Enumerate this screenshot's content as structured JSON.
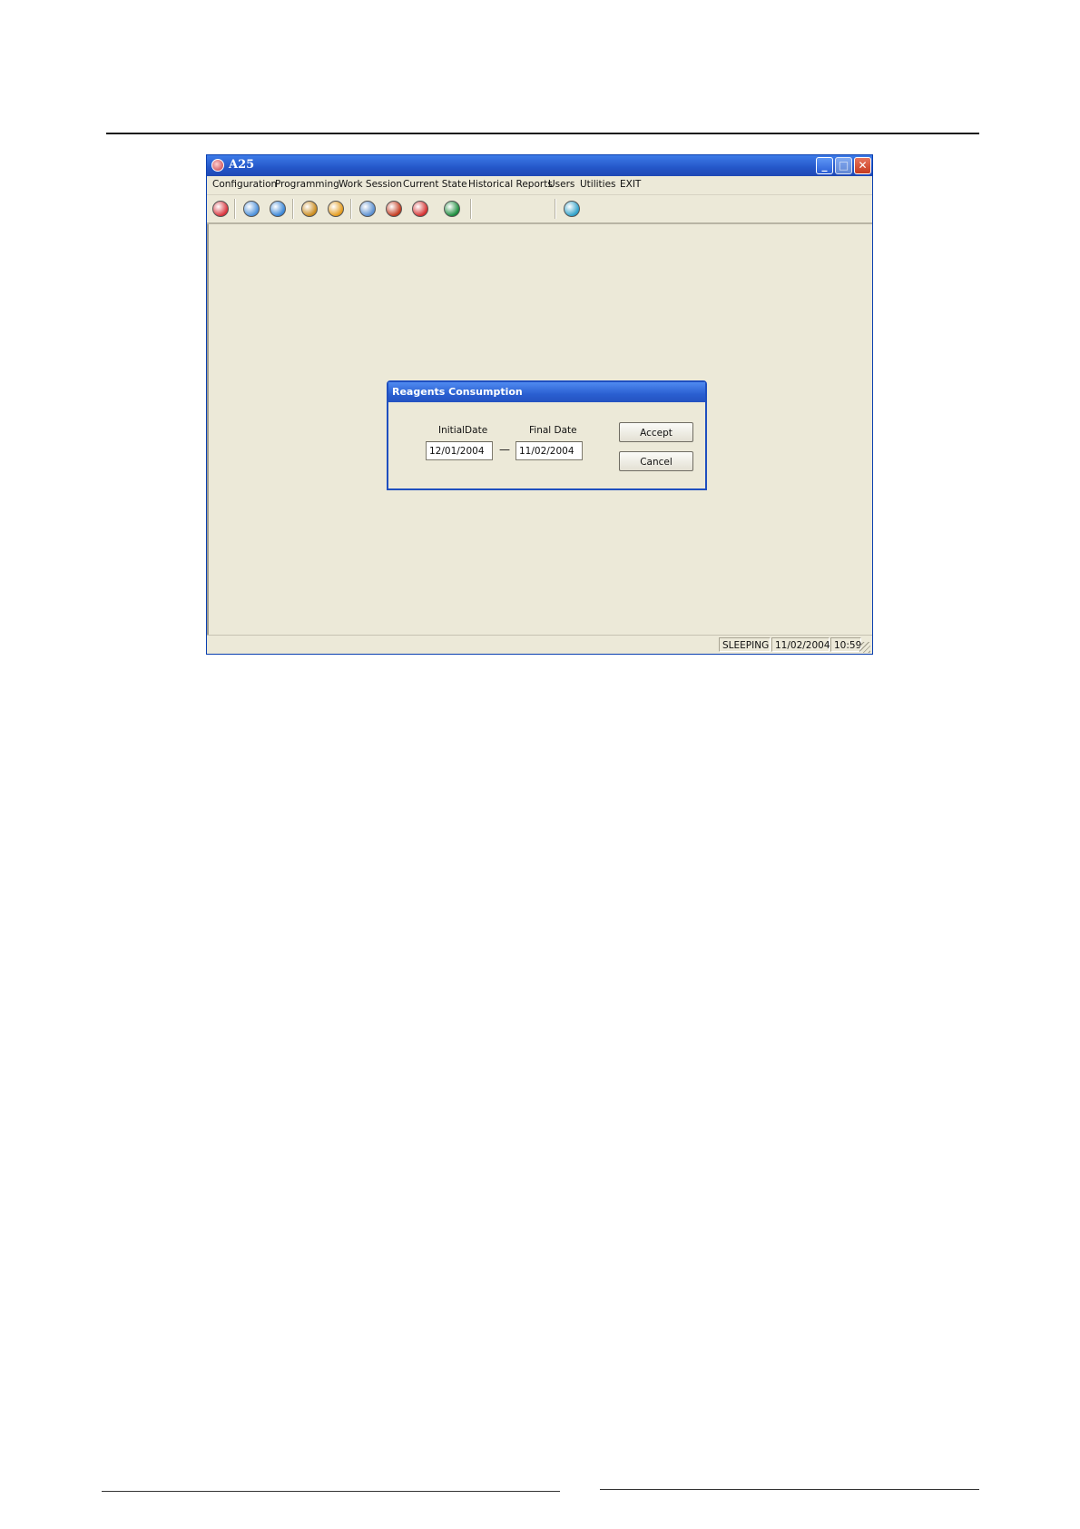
{
  "window": {
    "title": "A25"
  },
  "menu": [
    "Configuration",
    "Programming",
    "Work Session",
    "Current State",
    "Historical Reports",
    "Users",
    "Utilities",
    "EXIT"
  ],
  "toolbar_icons": [
    {
      "name": "stop-icon",
      "color": "#d8323b"
    },
    {
      "name": "snowflake-icon",
      "color": "#4b8fd9"
    },
    {
      "name": "globe-icon",
      "color": "#3a86d6"
    },
    {
      "name": "shield-icon",
      "color": "#c98a1c"
    },
    {
      "name": "refresh-icon",
      "color": "#e39b1c"
    },
    {
      "name": "pills-icon",
      "color": "#5a8fd0"
    },
    {
      "name": "book-icon",
      "color": "#c23a1f"
    },
    {
      "name": "curve-icon",
      "color": "#d43030"
    },
    {
      "name": "tool-icon",
      "color": "#1b8c3c"
    },
    {
      "name": "sun-icon",
      "color": "#2ea0c8"
    }
  ],
  "dialog": {
    "title": "Reagents Consumption",
    "initial_label": "InitialDate",
    "final_label": "Final Date",
    "initial_value": "12/01/2004",
    "final_value": "11/02/2004",
    "separator": "—",
    "accept_label": "Accept",
    "cancel_label": "Cancel"
  },
  "status": {
    "state": "SLEEPING",
    "date": "11/02/2004",
    "time": "10:59"
  }
}
